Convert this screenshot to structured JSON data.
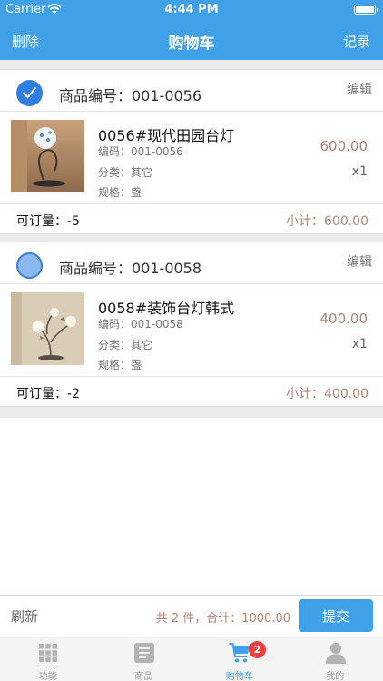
{
  "status_bar": {
    "carrier": "Carrier",
    "time": "4:44 PM"
  },
  "nav": {
    "left": "删除",
    "title": "购物车",
    "right": "记录"
  },
  "items": [
    {
      "selected": true,
      "code_label": "商品编号：001-0056",
      "edit_label": "编辑",
      "name": "0056#现代田园台灯",
      "code": "编码：001-0056",
      "category": "分类：其它",
      "spec": "规格：盏",
      "price": "600.00",
      "qty": "x1",
      "available": "可订量：-5",
      "subtotal": "小计：600.00"
    },
    {
      "selected": false,
      "code_label": "商品编号：001-0058",
      "edit_label": "编辑",
      "name": "0058#装饰台灯韩式",
      "code": "编码：001-0058",
      "category": "分类：其它",
      "spec": "规格：盏",
      "price": "400.00",
      "qty": "x1",
      "available": "可订量：-2",
      "subtotal": "小计：400.00"
    }
  ],
  "checkout": {
    "refresh": "刷新",
    "total": "共 2 件，合计：1000.00",
    "submit": "提交"
  },
  "tabs": [
    {
      "label": "功能",
      "icon": "grid-icon"
    },
    {
      "label": "商品",
      "icon": "document-icon"
    },
    {
      "label": "购物车",
      "icon": "cart-icon",
      "badge": "2",
      "active": true
    },
    {
      "label": "我的",
      "icon": "person-icon"
    }
  ],
  "colors": {
    "accent": "#41a1e8",
    "price": "#b08574",
    "badge": "#e94040"
  }
}
